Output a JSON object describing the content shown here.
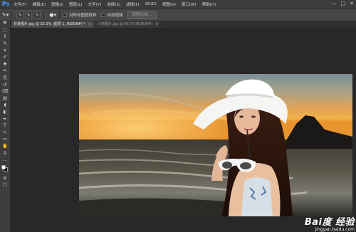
{
  "app": {
    "logo": "Ps",
    "menu": [
      "文件(F)",
      "编辑(E)",
      "图像(I)",
      "图层(L)",
      "文字(Y)",
      "选择(S)",
      "滤镜(T)",
      "3D(D)",
      "视图(V)",
      "窗口(W)",
      "帮助(H)"
    ],
    "window_controls": [
      "—",
      "□",
      "✕"
    ]
  },
  "options_bar": {
    "brush_icon": "brush-icon",
    "sample_all_layers_label": "对所有图层取样",
    "auto_enhance_label": "自动增强",
    "refine_edge_label": "调整边缘..."
  },
  "tabs": [
    {
      "label": "背景图片.jpg @ 33.3% (图层 1, RGB/8#) *",
      "close": "×",
      "active": true
    },
    {
      "label": "人物图片.jpg @ 66.7%(RGB/8#)",
      "close": "×",
      "active": false
    }
  ],
  "toolbar": {
    "tools": [
      "move-tool",
      "marquee-tool",
      "lasso-tool",
      "quick-selection-tool",
      "crop-tool",
      "eyedropper-tool",
      "healing-brush-tool",
      "brush-tool",
      "clone-stamp-tool",
      "history-brush-tool",
      "eraser-tool",
      "gradient-tool",
      "blur-tool",
      "dodge-tool",
      "pen-tool",
      "type-tool",
      "path-selection-tool",
      "shape-tool",
      "hand-tool",
      "zoom-tool"
    ],
    "glyphs": [
      "✥",
      "⬚",
      "ℓ",
      "✎",
      "⌗",
      "✐",
      "✚",
      "✏",
      "⎘",
      "↺",
      "⌫",
      "▤",
      "◖",
      "◐",
      "✒",
      "T",
      "↖",
      "▭",
      "✋",
      "⚲",
      "…",
      "⧈",
      "▢"
    ],
    "foreground_color": "#ffffff",
    "background_color": "#000000"
  },
  "canvas": {
    "background_color": "#282828",
    "image_description_sky": "#e8a040"
  },
  "watermark": {
    "logo": "Bai度 经验",
    "url": "jingyan.baidu.com"
  }
}
